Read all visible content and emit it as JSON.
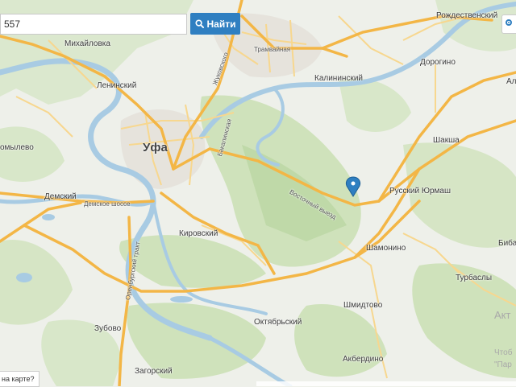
{
  "search": {
    "value": "557",
    "button_label": "Найти"
  },
  "report_link": "на карте?",
  "places": {
    "rozhdestvensky": "Рождественский",
    "mikhailovka": "Михайловка",
    "tramvaynaya": "Трамвайная",
    "leninsky": "Ленинский",
    "kalininsky": "Калининский",
    "dorogino": "Дорогино",
    "ufa": "Уфа",
    "shaksha": "Шакша",
    "omylevo": "омылево",
    "demsky": "Демский",
    "demskoe_shosse": "Демское шоссе",
    "vostochny_vyezd": "Восточный выезд",
    "russky_yurmash": "Русский Юрмаш",
    "kirovsky": "Кировский",
    "shamonino": "Шамонино",
    "turbasly": "Турбаслы",
    "shmidtovo": "Шмидтово",
    "orenburgsky_trakt": "Оренбургский тракт",
    "zubovo": "Зубово",
    "oktyabrsky": "Октябрьский",
    "akberdino": "Акбердино",
    "zagorsky": "Загорский",
    "bibas": "Бибас",
    "al": "Ал",
    "zhukovskogo": "Жуковского",
    "bakalinskaya": "Бакалинская"
  },
  "watermarks": {
    "activation": "Акт",
    "chtob": "Чтоб",
    "par": "\"Пар"
  },
  "colors": {
    "land": "#eef0ea",
    "forest": "#cfe2bb",
    "water": "#a8cbe3",
    "road_major": "#f3b646",
    "road_minor": "#f7d78f",
    "pin": "#2f7fc1",
    "button": "#2f7fc1"
  },
  "icons": {
    "search": "search-icon",
    "pin": "location-pin-icon"
  }
}
